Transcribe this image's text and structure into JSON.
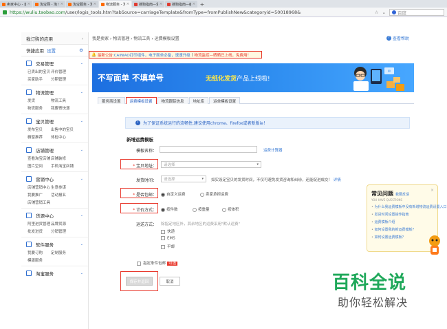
{
  "browser": {
    "tabs": [
      {
        "label": "卖家中心 - 首页",
        "active": false
      },
      {
        "label": "淘宝网 - 淘！我喜欢",
        "active": false
      },
      {
        "label": "淘宝服务 - 淘宝网",
        "active": false
      },
      {
        "label": "物流服务 - 淘宝网",
        "active": true
      },
      {
        "label": "搜狗指南—生活技能宝典",
        "active": false
      },
      {
        "label": "搜狗指南—编辑器",
        "active": false
      }
    ],
    "url_host": "https://wuliu.taobao.com",
    "url_rest": "/user/logis_tools.htm?tabSource=carriageTemplate&fromType=fromPublishNew&categoryid=50018968&",
    "search_placeholder": "百度"
  },
  "sidebar": {
    "my_apps": "我订购的应用",
    "quick_apps": "快捷应用",
    "settings_link": "设置",
    "sections": [
      {
        "title": "交易管理",
        "links": [
          "已卖出的宝贝",
          "评价管理",
          "买家助手",
          "分期管理"
        ]
      },
      {
        "title": "物流管理",
        "links": [
          "发货",
          "物流工具",
          "物流服务",
          "我要寄快递"
        ]
      },
      {
        "title": "宝贝管理",
        "links": [
          "发布宝贝",
          "出售中的宝贝",
          "橱窗推荐",
          "体检中心"
        ]
      },
      {
        "title": "店铺管理",
        "links": [
          "查看淘宝店铺",
          "店铺装修",
          "图片空间",
          "手机淘宝店铺"
        ]
      },
      {
        "title": "营销中心",
        "links": [
          "店铺营销中心",
          "生意参谋",
          "我要推广",
          "活动报名",
          "店铺营销工具"
        ]
      },
      {
        "title": "货源中心",
        "links": [
          "阿里进货管理",
          "品牌货源",
          "批发进货",
          "分销管理"
        ]
      },
      {
        "title": "软件服务",
        "links": [
          "我要订购",
          "定制服务",
          "模版服务"
        ]
      },
      {
        "title": "淘宝服务",
        "links": []
      }
    ]
  },
  "breadcrumb": "我是卖家 › 物流管理 › 物流工具 › 运费模板设置",
  "help_link": "查看帮助",
  "notice": {
    "prefix": "最新公告:",
    "text": "CAINIAO打印组件，电子面单必备，速速升级",
    "sep": "|",
    "link": "物流监控—晒晒已上线，免费用！"
  },
  "banner": {
    "headline": "不写面单 不填单号",
    "headline_yellow": "无纸化发货",
    "headline_tail": "产品上线啦!"
  },
  "tabs": [
    {
      "label": "服务商设置",
      "active": false
    },
    {
      "label": "运费模板设置",
      "active": true
    },
    {
      "label": "物流跟踪信息",
      "active": false
    },
    {
      "label": "地址库",
      "active": false
    },
    {
      "label": "运单模板设置",
      "active": false
    }
  ],
  "tip": "为了保证系统运行的流畅性,建议使用chrome、firefox或者新版ie！",
  "form": {
    "title": "新增运费模板",
    "template_name_label": "模板名称：",
    "calc_link": "运费计算器",
    "origin_label": "宝贝地址：",
    "origin_placeholder": "请选择",
    "ship_time_label": "发货时间：",
    "ship_time_placeholder": "请选择",
    "ship_time_note": "如实设定宝贝的发货时间，不仅可避免发货咨询和纠纷，还能促进成交！",
    "ship_time_link": "详情",
    "free_label": "是否包邮：",
    "free_options": [
      "自定义运费",
      "卖家承担运费"
    ],
    "calc_label": "计价方式：",
    "calc_options": [
      "按件数",
      "按重量",
      "按体积"
    ],
    "method_label": "运送方式：",
    "method_hint": "除指定地区外，其余地区的运费采用\"默认运费\"",
    "methods": [
      "快递",
      "EMS",
      "平邮"
    ],
    "condition_prefix": "指定条件包邮",
    "condition_badge": "可选",
    "save_button": "保存并返回",
    "cancel_button": "取消"
  },
  "faq": {
    "title": "常见问题",
    "feedback": "我要反馈",
    "subtitle": "YOU HAVE QUESTIONS",
    "items": [
      "为什么我运费模板中没有新增物流运费设置入口",
      "发货时间设置操作指南",
      "运费模板介绍",
      "如何设置我的新运费模板？",
      "如何设置运费模板？"
    ]
  },
  "watermark": {
    "line1": "百科全说",
    "line2": "助你轻松解决"
  }
}
